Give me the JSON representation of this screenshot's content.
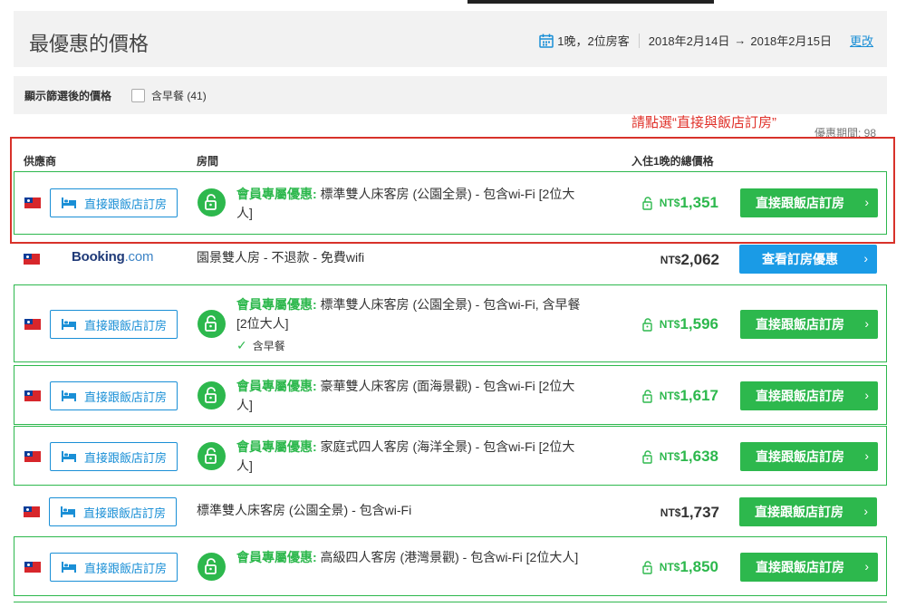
{
  "header": {
    "title": "最優惠的價格",
    "guests": "1晚，2位房客",
    "checkin": "2018年2月14日",
    "arrow": "→",
    "checkout": "2018年2月15日",
    "change_label": "更改"
  },
  "filter": {
    "label": "顯示篩選後的價格",
    "breakfast_label": "含早餐 (41)"
  },
  "annotation": "請點選“直接與飯店訂房”",
  "promo_period": "優惠期間:  98",
  "columns": {
    "provider": "供應商",
    "room": "房間",
    "price": "入住1晚的總價格"
  },
  "currency": "NT$",
  "member_prefix": "會員專屬優惠:",
  "direct_label": "直接跟飯店訂房",
  "cta_direct": "直接跟飯店訂房",
  "cta_booking": "查看訂房優惠",
  "booking_logo": {
    "main": "Booking",
    "suffix": ".com"
  },
  "breakfast_included": "含早餐",
  "offers": [
    {
      "room": " 標準雙人床客房 (公園全景) - 包含wi-Fi [2位大人]",
      "price": "1,351"
    },
    {
      "room": "園景雙人房 - 不退款 - 免費wifi",
      "price": "2,062"
    },
    {
      "room": " 標準雙人床客房 (公園全景) - 包含wi-Fi, 含早餐 [2位大人]",
      "price": "1,596"
    },
    {
      "room": " 豪華雙人床客房 (面海景觀) - 包含wi-Fi [2位大人]",
      "price": "1,617"
    },
    {
      "room": " 家庭式四人客房 (海洋全景) - 包含wi-Fi [2位大人]",
      "price": "1,638"
    },
    {
      "room": "標準雙人床客房 (公園全景) - 包含wi-Fi",
      "price": "1,737"
    },
    {
      "room": " 高級四人客房 (港灣景觀) - 包含wi-Fi [2位大人]",
      "price": "1,850"
    }
  ],
  "colors": {
    "green": "#2db84d",
    "blue": "#1a8fd6",
    "red": "#d8322a"
  },
  "icons": [
    "calendar-icon",
    "bed-icon",
    "unlock-icon",
    "check-icon",
    "chevron-right-icon",
    "taiwan-flag-icon"
  ]
}
